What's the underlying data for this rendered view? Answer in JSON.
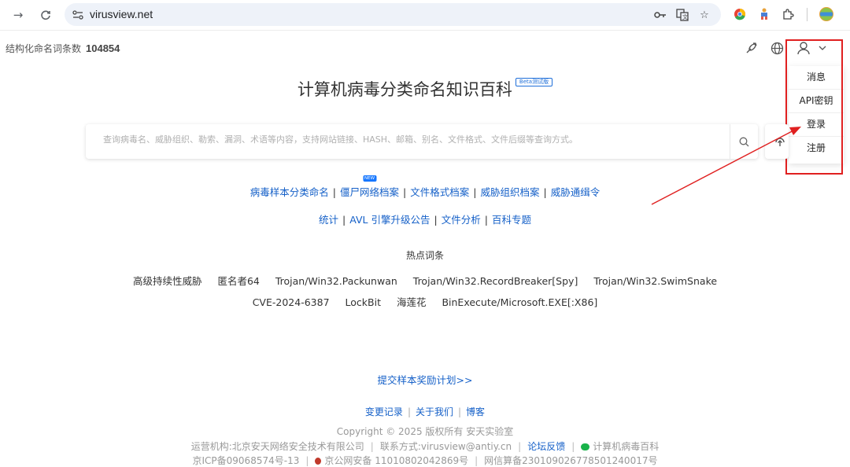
{
  "browser": {
    "url": "virusview.net"
  },
  "header": {
    "stat_label": "结构化命名词条数",
    "stat_value": "104854"
  },
  "user_menu": {
    "items": [
      "消息",
      "API密钥",
      "登录",
      "注册"
    ]
  },
  "main": {
    "title": "计算机病毒分类命名知识百科",
    "beta_badge": "Beta测试版",
    "search_placeholder": "查询病毒名、威胁组织、勒索、漏洞、术语等内容，支持网站链接、HASH、邮箱、别名、文件格式、文件后缀等查询方式。",
    "links_row1": [
      "病毒样本分类命名",
      "僵尸网络档案",
      "文件格式档案",
      "威胁组织档案",
      "威胁通缉令"
    ],
    "new_badge": "NEW",
    "links_row2": [
      "统计",
      "AVL 引擎升级公告",
      "文件分析",
      "百科专题"
    ],
    "hot_title": "热点词条",
    "hot_row1": [
      "高级持续性威胁",
      "匿名者64",
      "Trojan/Win32.Packunwan",
      "Trojan/Win32.RecordBreaker[Spy]",
      "Trojan/Win32.SwimSnake"
    ],
    "hot_row2": [
      "CVE-2024-6387",
      "LockBit",
      "海莲花",
      "BinExecute/Microsoft.EXE[:X86]"
    ],
    "reward_link": "提交样本奖励计划>>"
  },
  "footer": {
    "links": [
      "变更记录",
      "关于我们",
      "博客"
    ],
    "copyright": "Copyright © 2025 版权所有  安天实验室",
    "operator": "运营机构:北京安天网络安全技术有限公司",
    "contact": "联系方式:virusview@antiy.cn",
    "forum": "论坛反馈",
    "wechat": "计算机病毒百科",
    "icp": "京ICP备09068574号-13",
    "police": "京公网安备 11010802042869号",
    "cac": "网信算备230109026778501240017号"
  },
  "colors": {
    "link": "#1560c8",
    "annotation": "#e02020"
  }
}
